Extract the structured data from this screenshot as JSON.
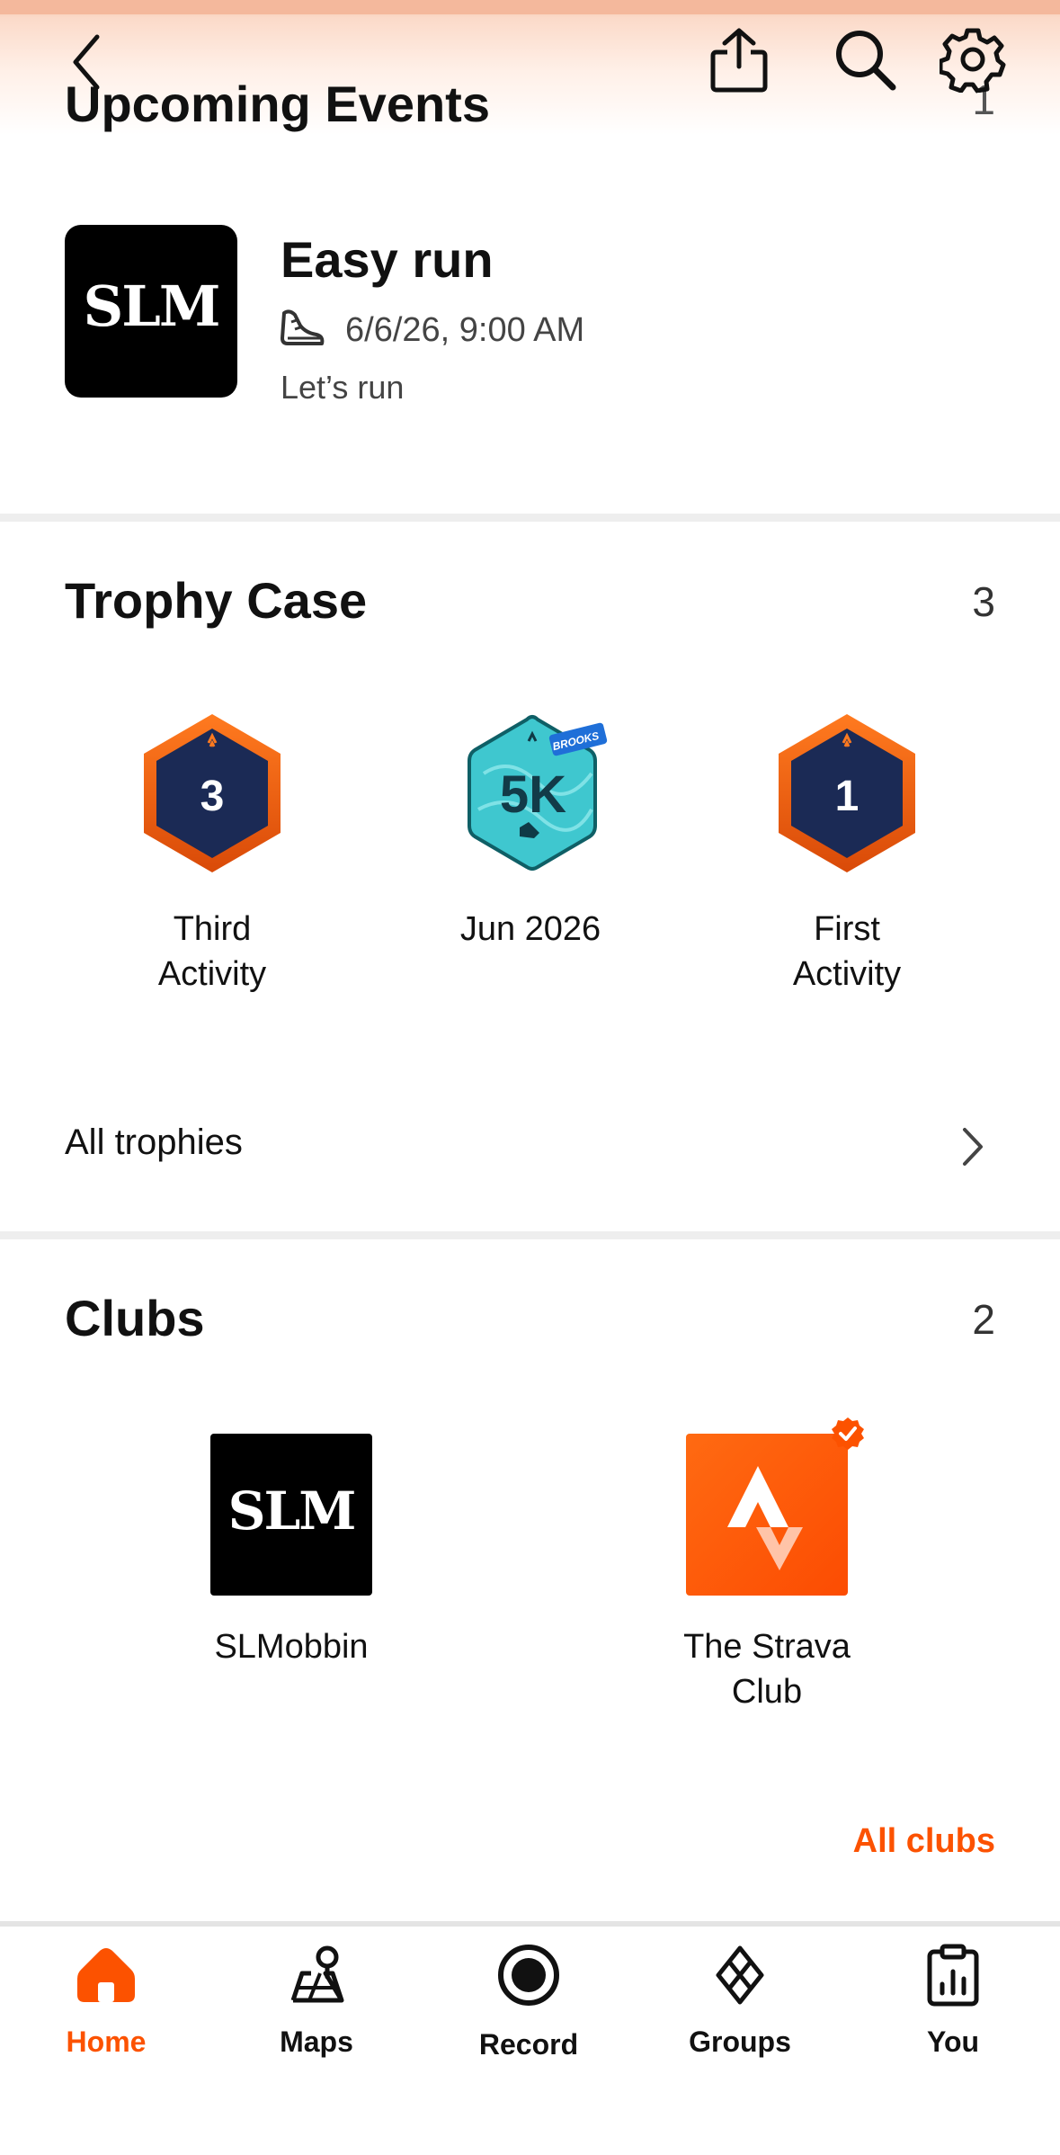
{
  "header": {
    "partial_title": "Upcoming Events",
    "partial_count": "1"
  },
  "event": {
    "logo_text": "SLM",
    "title": "Easy run",
    "datetime": "6/6/26, 9:00 AM",
    "description": "Let’s run"
  },
  "trophy_case": {
    "title": "Trophy Case",
    "count": "3",
    "trophies": [
      {
        "badge": "3",
        "label_line1": "Third",
        "label_line2": "Activity"
      },
      {
        "badge": "5K",
        "badge_tag": "BROOKS",
        "label_line1": "Jun 2026",
        "label_line2": ""
      },
      {
        "badge": "1",
        "label_line1": "First",
        "label_line2": "Activity"
      }
    ],
    "all_link": "All trophies"
  },
  "clubs": {
    "title": "Clubs",
    "count": "2",
    "items": [
      {
        "logo_text": "SLM",
        "label_line1": "SLMobbin",
        "label_line2": ""
      },
      {
        "label_line1": "The Strava",
        "label_line2": "Club"
      }
    ],
    "all_link": "All clubs"
  },
  "nav": {
    "items": [
      {
        "label": "Home",
        "icon": "home-icon",
        "active": true
      },
      {
        "label": "Maps",
        "icon": "maps-icon",
        "active": false
      },
      {
        "label": "Record",
        "icon": "record-icon",
        "active": false
      },
      {
        "label": "Groups",
        "icon": "groups-icon",
        "active": false
      },
      {
        "label": "You",
        "icon": "you-icon",
        "active": false
      }
    ]
  },
  "colors": {
    "accent": "#fc5200",
    "trophy_navy": "#1b2a55",
    "badge_teal": "#3fc7cf",
    "divider": "#eeeeee"
  }
}
